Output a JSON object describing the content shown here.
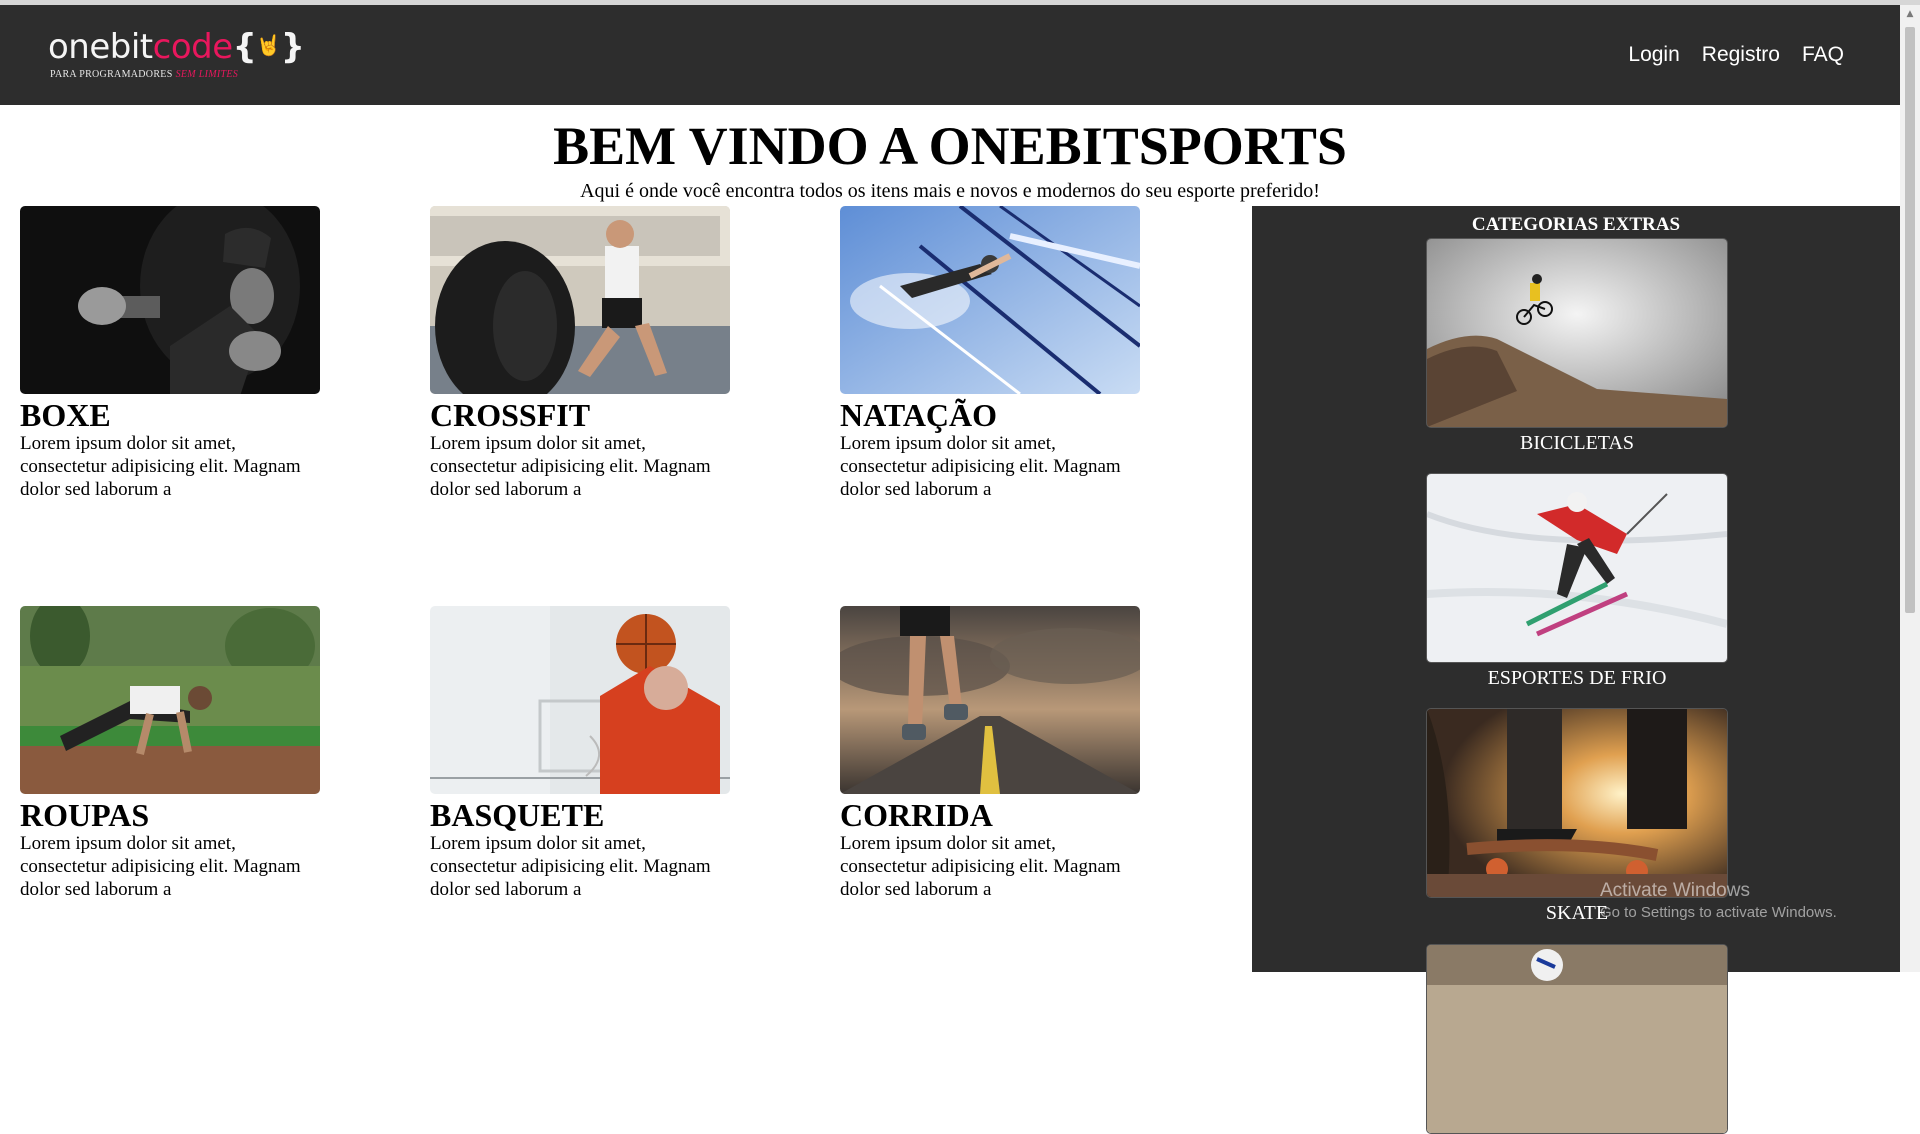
{
  "navbar": {
    "logo": {
      "word_part1": "onebit",
      "word_part2": "code",
      "brace_open": "{",
      "brace_close": "}",
      "hand_glyph": "🤘",
      "tagline": "PARA PROGRAMADORES",
      "tagline_accent": "SEM LIMITES"
    },
    "links": [
      {
        "label": "Login"
      },
      {
        "label": "Registro"
      },
      {
        "label": "FAQ"
      }
    ]
  },
  "hero": {
    "title": "BEM VINDO A ONEBITSPORTS",
    "subtitle": "Aqui é onde você encontra todos os itens mais e novos e modernos do seu esporte preferido!"
  },
  "sports": [
    {
      "title": "BOXE",
      "text": "Lorem ipsum dolor sit amet, consectetur adipisicing elit. Magnam dolor sed laborum a",
      "image": "boxer-photo"
    },
    {
      "title": "CROSSFIT",
      "text": "Lorem ipsum dolor sit amet, consectetur adipisicing elit. Magnam dolor sed laborum a",
      "image": "tire-flip-photo"
    },
    {
      "title": "NATAÇÃO",
      "text": "Lorem ipsum dolor sit amet, consectetur adipisicing elit. Magnam dolor sed laborum a",
      "image": "swimmer-photo"
    },
    {
      "title": "ROUPAS",
      "text": "Lorem ipsum dolor sit amet, consectetur adipisicing elit. Magnam dolor sed laborum a",
      "image": "pushup-photo"
    },
    {
      "title": "BASQUETE",
      "text": "Lorem ipsum dolor sit amet, consectetur adipisicing elit. Magnam dolor sed laborum a",
      "image": "basketball-photo"
    },
    {
      "title": "CORRIDA",
      "text": "Lorem ipsum dolor sit amet, consectetur adipisicing elit. Magnam dolor sed laborum a",
      "image": "runner-photo"
    }
  ],
  "sidebar": {
    "title": "CATEGORIAS EXTRAS",
    "items": [
      {
        "label": "BICICLETAS",
        "image": "mountain-bike-photo"
      },
      {
        "label": "ESPORTES DE FRIO",
        "image": "skier-photo"
      },
      {
        "label": "SKATE",
        "image": "skateboard-photo"
      },
      {
        "label": "",
        "image": "football-photo"
      }
    ]
  },
  "watermark": {
    "line1": "Activate Windows",
    "line2": "Go to Settings to activate Windows."
  },
  "colors": {
    "navbar_bg": "#2d2d2d",
    "brand_accent": "#e8175d",
    "sidebar_bg": "#2d2d2d"
  }
}
